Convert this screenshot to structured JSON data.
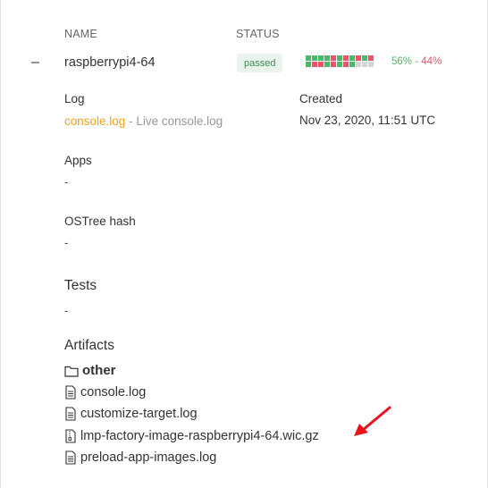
{
  "columns": {
    "name": "NAME",
    "status": "STATUS"
  },
  "device": {
    "collapse_symbol": "–",
    "name": "raspberrypi4-64",
    "status": "passed",
    "pass_percent": "56%",
    "separator": "-",
    "fail_percent": "44%",
    "status_colors": {
      "passed": "#4cb86a",
      "failed": "#e8546b",
      "empty": "#d4d4d4"
    }
  },
  "log": {
    "label": "Log",
    "link": "console.log",
    "separator": " - ",
    "live": "Live console.log"
  },
  "created": {
    "label": "Created",
    "value": "Nov 23, 2020, 11:51 UTC"
  },
  "apps": {
    "label": "Apps",
    "value": "-"
  },
  "ostree": {
    "label": "OSTree hash",
    "value": "-"
  },
  "tests": {
    "label": "Tests",
    "value": "-"
  },
  "artifacts": {
    "label": "Artifacts",
    "folder": {
      "icon": "folder-icon",
      "name": "other"
    },
    "files": [
      {
        "icon": "file-text-icon",
        "name": "console.log"
      },
      {
        "icon": "file-text-icon",
        "name": "customize-target.log"
      },
      {
        "icon": "file-archive-icon",
        "name": "lmp-factory-image-raspberrypi4-64.wic.gz"
      },
      {
        "icon": "file-text-icon",
        "name": "preload-app-images.log"
      }
    ]
  },
  "annotation": {
    "icon": "red-arrow-icon",
    "color": "#e8141c"
  }
}
